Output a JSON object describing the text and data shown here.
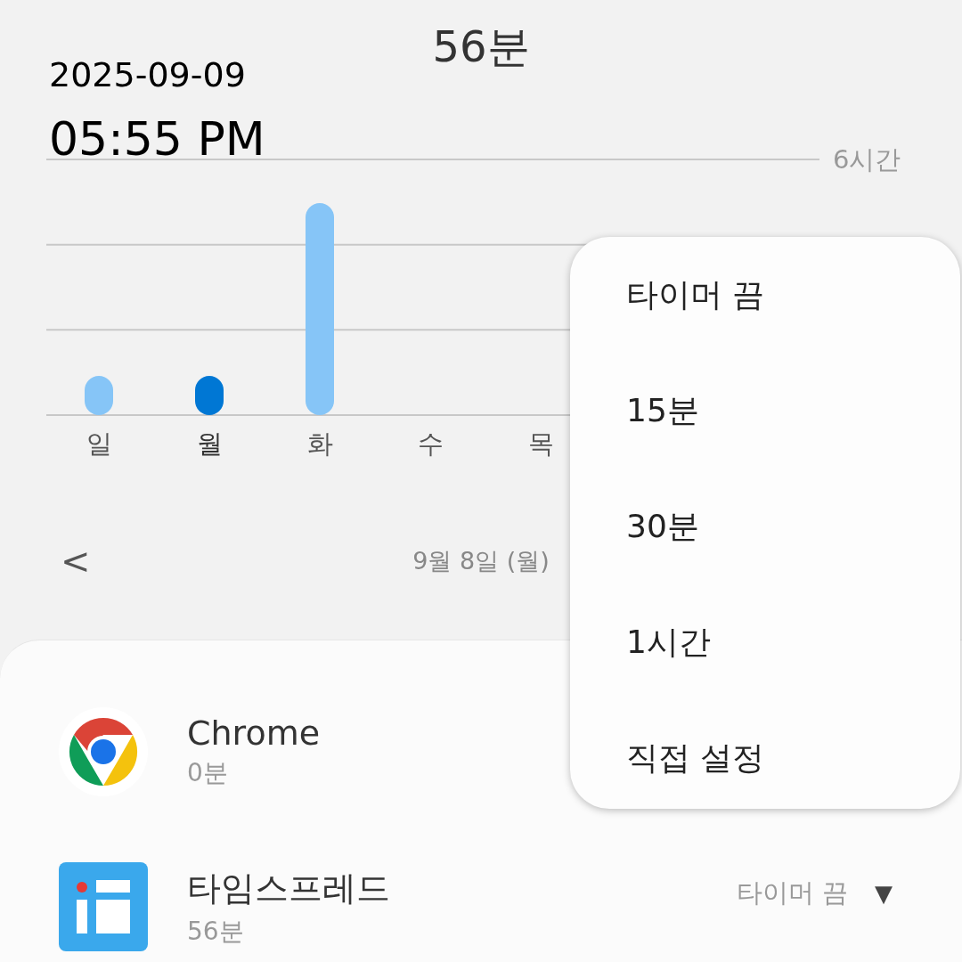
{
  "total_time": "56분",
  "timestamp": {
    "date": "2025-09-09",
    "time": "05:55 PM"
  },
  "chart": {
    "axis_label": "6시간",
    "days": [
      {
        "label": "일",
        "selected": false
      },
      {
        "label": "월",
        "selected": true
      },
      {
        "label": "화",
        "selected": false
      },
      {
        "label": "수",
        "selected": false
      },
      {
        "label": "목",
        "selected": false
      }
    ]
  },
  "date_nav": {
    "previous": "<",
    "date": "9월 8일 (월)"
  },
  "apps": [
    {
      "kind": "chrome",
      "name": "Chrome",
      "usage": "0분"
    },
    {
      "kind": "timespread",
      "name": "타임스프레드",
      "usage": "56분",
      "timer": "타이머 끔",
      "timer_caret": "▼"
    }
  ],
  "timer_menu": {
    "items": [
      {
        "label": "타이머 끔"
      },
      {
        "label": "15분"
      },
      {
        "label": "30분"
      },
      {
        "label": "1시간"
      },
      {
        "label": "직접 설정"
      }
    ]
  }
}
